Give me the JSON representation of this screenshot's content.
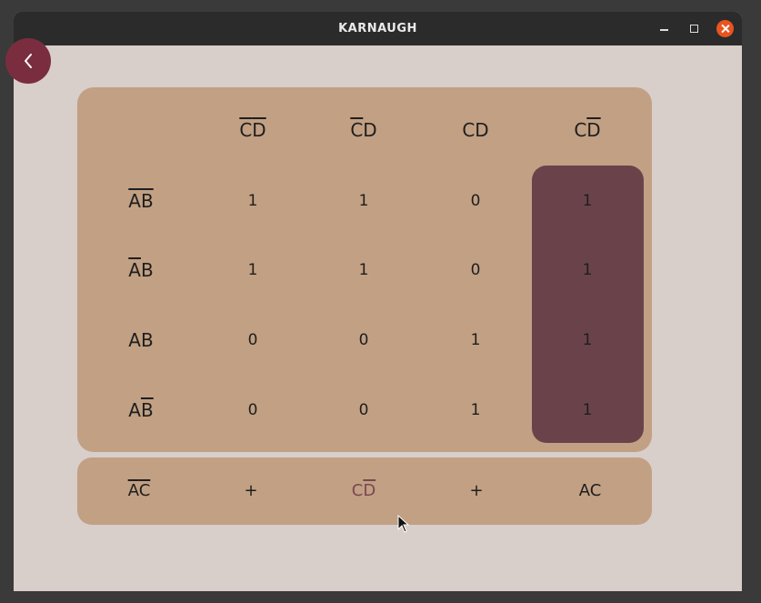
{
  "window": {
    "title": "KARNAUGH"
  },
  "kmap": {
    "column_headers": [
      {
        "a": "C",
        "a_bar": true,
        "b": "D",
        "b_bar": true
      },
      {
        "a": "C",
        "a_bar": true,
        "b": "D",
        "b_bar": false
      },
      {
        "a": "C",
        "a_bar": false,
        "b": "D",
        "b_bar": false
      },
      {
        "a": "C",
        "a_bar": false,
        "b": "D",
        "b_bar": true
      }
    ],
    "row_headers": [
      {
        "a": "A",
        "a_bar": true,
        "b": "B",
        "b_bar": true
      },
      {
        "a": "A",
        "a_bar": true,
        "b": "B",
        "b_bar": false
      },
      {
        "a": "A",
        "a_bar": false,
        "b": "B",
        "b_bar": false
      },
      {
        "a": "A",
        "a_bar": false,
        "b": "B",
        "b_bar": true
      }
    ],
    "values": [
      [
        "1",
        "1",
        "0",
        "1"
      ],
      [
        "1",
        "1",
        "0",
        "1"
      ],
      [
        "0",
        "0",
        "1",
        "1"
      ],
      [
        "0",
        "0",
        "1",
        "1"
      ]
    ],
    "highlighted_column": 3
  },
  "result": {
    "terms": [
      {
        "a": "A",
        "a_bar": true,
        "b": "C",
        "b_bar": true,
        "active": false
      },
      {
        "a": "C",
        "a_bar": false,
        "b": "D",
        "b_bar": true,
        "active": true
      },
      {
        "a": "A",
        "a_bar": false,
        "b": "C",
        "b_bar": false,
        "active": false
      }
    ],
    "operator": "+"
  },
  "colors": {
    "accent": "#7b2d40",
    "panel": "#c2a083",
    "highlight": "#6a434a",
    "background": "#d8ceca",
    "active_term": "#7a4752"
  },
  "icons": {
    "back": "chevron-left-icon",
    "cursor": "mouse-pointer-icon"
  }
}
